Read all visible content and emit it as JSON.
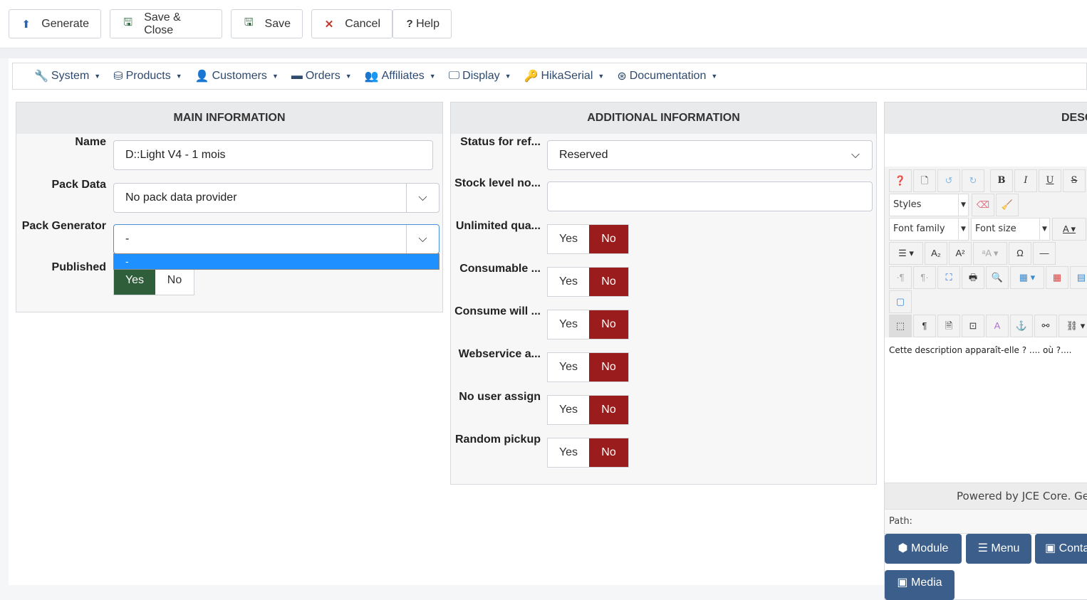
{
  "toolbar": {
    "generate": "Generate",
    "save_close": "Save & Close",
    "save": "Save",
    "cancel": "Cancel",
    "help": "Help"
  },
  "nav": [
    "System",
    "Products",
    "Customers",
    "Orders",
    "Affiliates",
    "Display",
    "HikaSerial",
    "Documentation"
  ],
  "main": {
    "title": "MAIN INFORMATION",
    "name_label": "Name",
    "name_value": "D::Light V4 - 1 mois",
    "pack_data_label": "Pack Data",
    "pack_data_value": "No pack data provider",
    "pack_gen_label": "Pack Generator",
    "pack_gen_value": "-",
    "dropdown_option": "-",
    "published_label": "Published",
    "yes": "Yes",
    "no": "No"
  },
  "additional": {
    "title": "ADDITIONAL INFORMATION",
    "status_label": "Status for ref...",
    "status_value": "Reserved",
    "stock_label": "Stock level no...",
    "stock_value": "",
    "toggles": [
      {
        "label": "Unlimited qua..."
      },
      {
        "label": "Consumable ..."
      },
      {
        "label": "Consume will ..."
      },
      {
        "label": "Webservice a..."
      },
      {
        "label": "No user assign"
      },
      {
        "label": "Random pickup"
      }
    ],
    "yes": "Yes",
    "no": "No"
  },
  "description": {
    "title": "DESC",
    "styles": "Styles",
    "font_family": "Font family",
    "font_size": "Font size",
    "text": "Cette description apparaît-elle ? .... où ?....",
    "powered": "Powered by JCE Core. Get",
    "path": "Path:",
    "buttons": [
      "Module",
      "Menu",
      "Conta",
      "Media"
    ]
  }
}
